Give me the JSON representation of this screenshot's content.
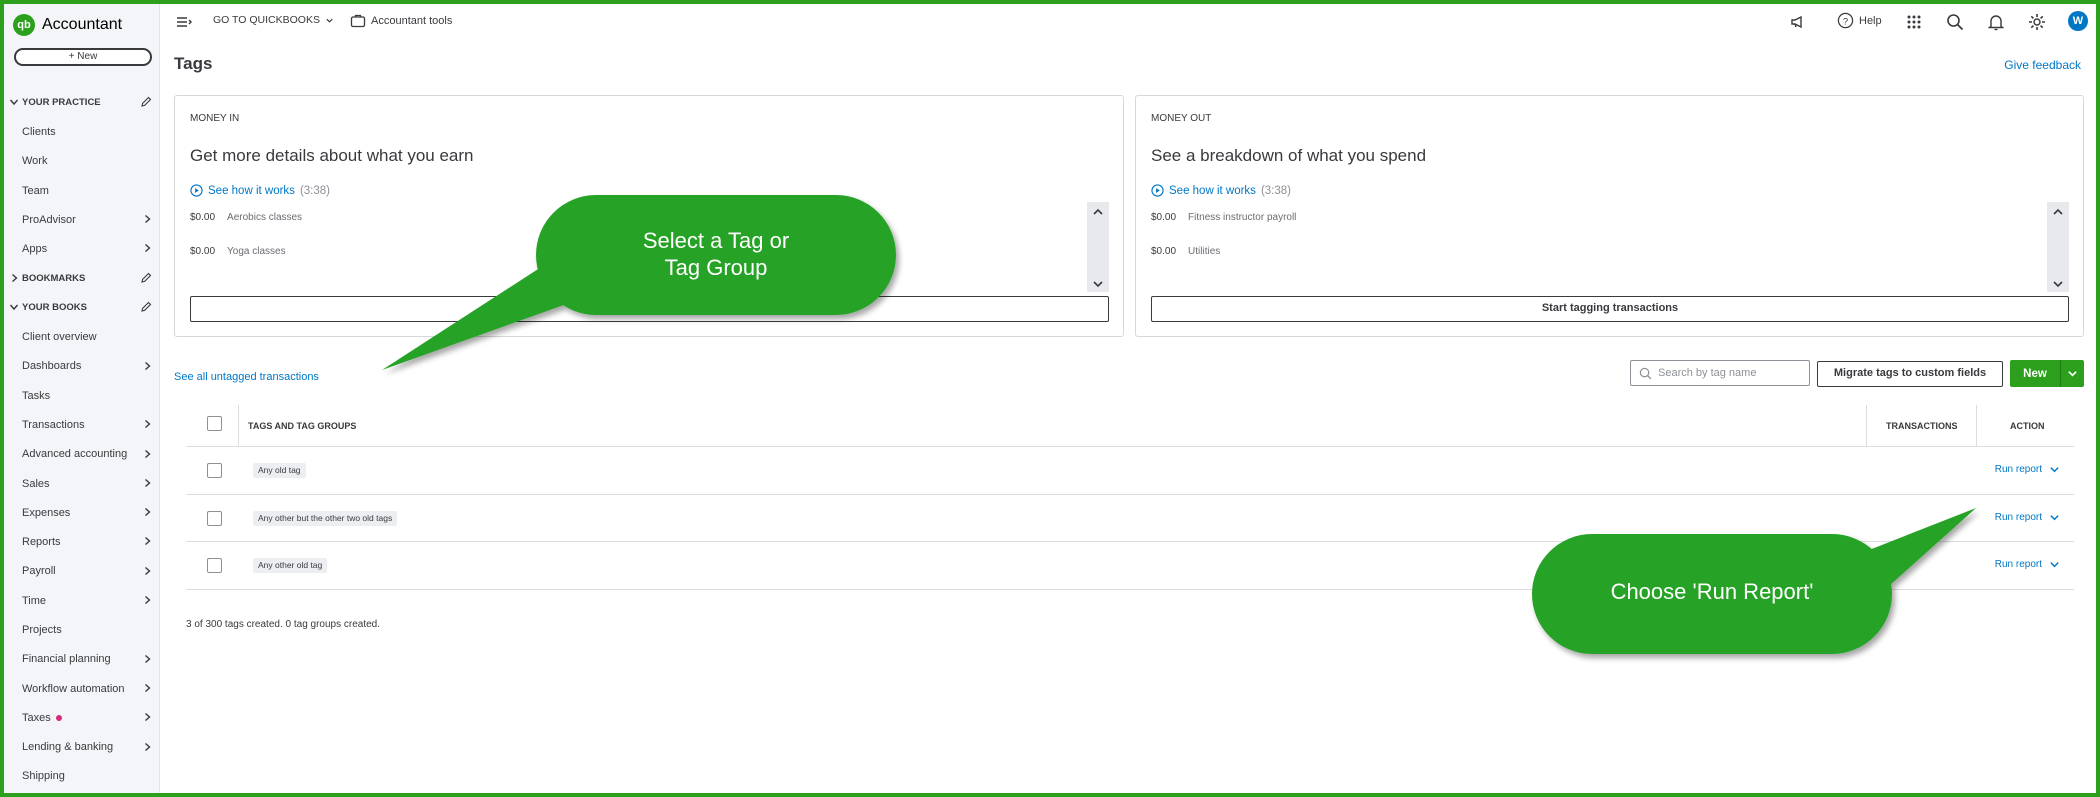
{
  "brand": {
    "name": "Accountant",
    "logo_text": "qb"
  },
  "sidebar": {
    "new_label": "+ New",
    "items": [
      {
        "label": "YOUR PRACTICE",
        "type": "section",
        "expanded": true,
        "edit": true
      },
      {
        "label": "Clients"
      },
      {
        "label": "Work"
      },
      {
        "label": "Team"
      },
      {
        "label": "ProAdvisor",
        "arrow": true
      },
      {
        "label": "Apps",
        "arrow": true
      },
      {
        "label": "BOOKMARKS",
        "type": "section",
        "expanded": false,
        "edit": true
      },
      {
        "label": "YOUR BOOKS",
        "type": "section",
        "expanded": true,
        "edit": true
      },
      {
        "label": "Client overview"
      },
      {
        "label": "Dashboards",
        "arrow": true
      },
      {
        "label": "Tasks"
      },
      {
        "label": "Transactions",
        "arrow": true
      },
      {
        "label": "Advanced accounting",
        "arrow": true
      },
      {
        "label": "Sales",
        "arrow": true
      },
      {
        "label": "Expenses",
        "arrow": true
      },
      {
        "label": "Reports",
        "arrow": true
      },
      {
        "label": "Payroll",
        "arrow": true
      },
      {
        "label": "Time",
        "arrow": true
      },
      {
        "label": "Projects"
      },
      {
        "label": "Financial planning",
        "arrow": true
      },
      {
        "label": "Workflow automation",
        "arrow": true
      },
      {
        "label": "Taxes",
        "arrow": true,
        "dot": true
      },
      {
        "label": "Lending & banking",
        "arrow": true
      },
      {
        "label": "Shipping"
      }
    ]
  },
  "topbar": {
    "go_to_qb": "GO TO QUICKBOOKS",
    "accountant_tools": "Accountant tools",
    "help": "Help",
    "avatar": "W"
  },
  "page": {
    "title": "Tags",
    "give_feedback": "Give feedback",
    "money_in": {
      "label": "MONEY IN",
      "heading": "Get more details about what you earn",
      "link": "See how it works",
      "duration": "(3:38)",
      "rows": [
        {
          "amount": "$0.00",
          "category": "Aerobics classes"
        },
        {
          "amount": "$0.00",
          "category": "Yoga classes"
        }
      ],
      "button": "Start tagging transactions"
    },
    "money_out": {
      "label": "MONEY OUT",
      "heading": "See a breakdown of what you spend",
      "link": "See how it works",
      "duration": "(3:38)",
      "rows": [
        {
          "amount": "$0.00",
          "category": "Fitness instructor payroll"
        },
        {
          "amount": "$0.00",
          "category": "Utilities"
        }
      ],
      "button": "Start tagging transactions"
    },
    "untagged_link": "See all untagged transactions",
    "search_placeholder": "Search by tag name",
    "migrate_button": "Migrate tags to custom fields",
    "new_button": "New",
    "table": {
      "headers": {
        "name": "TAGS AND TAG GROUPS",
        "transactions": "TRANSACTIONS",
        "action": "ACTION"
      },
      "rows": [
        {
          "tag": "Any old tag",
          "action": "Run report"
        },
        {
          "tag": "Any other but the other two old tags",
          "action": "Run report"
        },
        {
          "tag": "Any other old tag",
          "action": "Run report"
        }
      ]
    },
    "footer_note": "3 of 300 tags created. 0 tag groups created."
  },
  "callouts": {
    "select_tag_line1": "Select a Tag or",
    "select_tag_line2": "Tag Group",
    "run_report": "Choose 'Run Report'",
    "color": "#28a228"
  }
}
